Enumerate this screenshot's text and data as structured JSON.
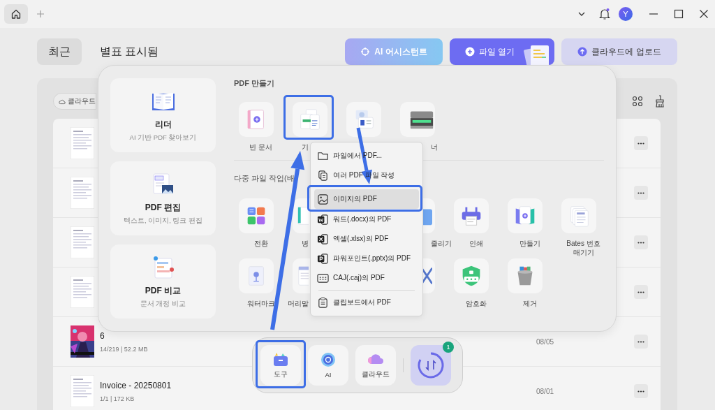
{
  "title_bar": {
    "avatar": "Y"
  },
  "tabs": [
    {
      "label": "최근",
      "selected": true
    },
    {
      "label": "별표 표시됨",
      "selected": false
    }
  ],
  "actions": [
    {
      "label": "AI 어시스턴트",
      "kind": "ai"
    },
    {
      "label": "파일 열기",
      "kind": "open"
    },
    {
      "label": "클라우드에 업로드",
      "kind": "upload"
    }
  ],
  "filter_chip": "클라우드",
  "files": [
    {
      "kind": "document"
    },
    {
      "kind": "document"
    },
    {
      "kind": "document"
    },
    {
      "kind": "document"
    },
    {
      "kind": "picture",
      "name": "6",
      "meta": "14/219 | 52.2 MB",
      "date": "08/05"
    },
    {
      "kind": "document",
      "name": "Invoice - 20250801",
      "meta": "1/1 | 172 KB",
      "date": "08/01"
    }
  ],
  "tools_panel": {
    "cards": [
      {
        "title": "리더",
        "subtitle": "AI 기반 PDF 찾아보기"
      },
      {
        "title": "PDF 편집",
        "subtitle": "텍스트, 이미지, 링크 편집"
      },
      {
        "title": "PDF 비교",
        "subtitle": "문서 개정 비교"
      }
    ],
    "sections": [
      {
        "heading": "PDF 만들기",
        "rows": [
          [
            {
              "kind": "tile",
              "label": "빈 문서"
            },
            {
              "kind": "cut_right",
              "label": "기",
              "highlighted": true
            },
            {
              "kind": "tile"
            },
            {
              "kind": "cut_left",
              "label": "너"
            }
          ]
        ]
      },
      {
        "heading": "다중 파일 작업(배",
        "rows": [
          [
            {
              "kind": "tile",
              "label": "전환"
            },
            {
              "kind": "cut_right",
              "label": "병"
            },
            {
              "kind": "covered"
            },
            {
              "kind": "cut_left",
              "label": "줄리기"
            },
            {
              "kind": "tile",
              "label": "인쇄"
            },
            {
              "kind": "tile",
              "label": "만들기"
            },
            {
              "kind": "tile",
              "label": "Bates 번호 매기기"
            }
          ],
          [
            {
              "kind": "tile",
              "label": "워터마크"
            },
            {
              "kind": "cut_right",
              "label": "머리말"
            },
            {
              "kind": "covered"
            },
            {
              "kind": "cut_left"
            },
            {
              "kind": "tile",
              "label": "암호화"
            },
            {
              "kind": "tile",
              "label": "제거"
            }
          ]
        ]
      }
    ]
  },
  "menu": {
    "items": [
      {
        "label": "파일에서 PDF...",
        "selected": false,
        "separator_above": false
      },
      {
        "label": "여러 PDF 파일 작성",
        "selected": false,
        "separator_above": false
      },
      {
        "label": "이미지의 PDF",
        "selected": true,
        "highlighted": true,
        "separator_above": false
      },
      {
        "label": "워드(.docx)의 PDF",
        "selected": false,
        "separator_above": false
      },
      {
        "label": "엑셀(.xlsx)의 PDF",
        "selected": false,
        "separator_above": false
      },
      {
        "label": "파워포인트(.pptx)의 PDF",
        "selected": false,
        "separator_above": false
      },
      {
        "label": "CAJ(.caj)의 PDF",
        "selected": false,
        "separator_above": false
      },
      {
        "label": "클립보드에서 PDF",
        "selected": false,
        "separator_above": true
      }
    ]
  },
  "dock": {
    "items": [
      {
        "label": "도구",
        "highlighted": true
      },
      {
        "label": "AI",
        "highlighted": false
      },
      {
        "label": "클라우드",
        "highlighted": false
      }
    ],
    "sync_badge": "1"
  }
}
